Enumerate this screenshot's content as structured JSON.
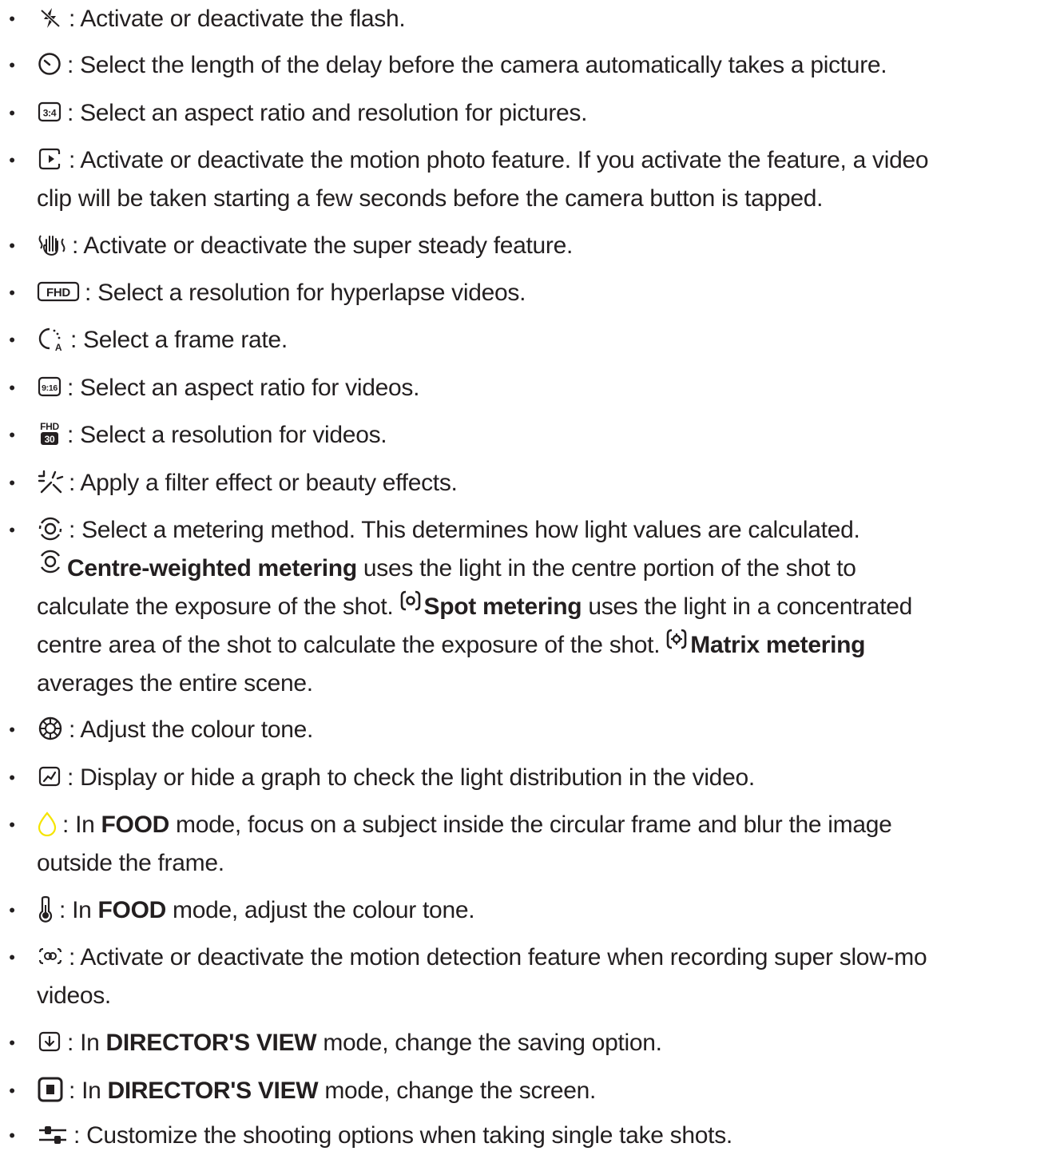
{
  "items": [
    {
      "icon": "flash-off-icon",
      "text": ": Activate or deactivate the flash."
    },
    {
      "icon": "timer-icon",
      "text": ": Select the length of the delay before the camera automatically takes a picture."
    },
    {
      "icon": "aspect-ratio-3-4-icon",
      "icon_text": "3:4",
      "text": ": Select an aspect ratio and resolution for pictures."
    },
    {
      "icon": "motion-photo-icon",
      "text": ": Activate or deactivate the motion photo feature. If you activate the feature, a video",
      "text2": "clip will be taken starting a few seconds before the camera button is tapped."
    },
    {
      "icon": "super-steady-hand-icon",
      "text": ": Activate or deactivate the super steady feature."
    },
    {
      "icon": "fhd-resolution-icon",
      "icon_text": "FHD",
      "text": ": Select a resolution for hyperlapse videos."
    },
    {
      "icon": "frame-rate-auto-icon",
      "icon_text": "A",
      "text": ": Select a frame rate."
    },
    {
      "icon": "aspect-ratio-9-16-icon",
      "icon_text": "9:16",
      "text": ": Select an aspect ratio for videos."
    },
    {
      "icon": "video-resolution-fhd30-icon",
      "icon_text": "FHD",
      "icon_text2": "30",
      "text": ": Select a resolution for videos."
    },
    {
      "icon": "filter-effects-icon",
      "text": ": Apply a filter effect or beauty effects."
    },
    {
      "icon": "metering-icon",
      "text": ": Select a metering method. This determines how light values are calculated.",
      "centre_bold": "Centre-weighted metering",
      "centre_rest": " uses the light in the centre portion of the shot to",
      "line3_a": "calculate the exposure of the shot.",
      "spot_bold": "Spot metering",
      "line3_b": " uses the light in a concentrated",
      "line4_a": "centre area of the shot to calculate the exposure of the shot.",
      "matrix_bold": "Matrix metering",
      "line5": "averages the entire scene."
    },
    {
      "icon": "colour-tone-icon",
      "text": ": Adjust the colour tone."
    },
    {
      "icon": "histogram-graph-icon",
      "text": ": Display or hide a graph to check the light distribution in the video."
    },
    {
      "icon": "food-focus-drop-icon",
      "pre": ": In ",
      "bold": "FOOD",
      "post": " mode, focus on a subject inside the circular frame and blur the image",
      "text2": "outside the frame.",
      "accent": "#f5e400"
    },
    {
      "icon": "thermometer-icon",
      "pre": ": In ",
      "bold": "FOOD",
      "post": " mode, adjust the colour tone."
    },
    {
      "icon": "motion-detection-icon",
      "text": ": Activate or deactivate the motion detection feature when recording super slow-mo",
      "text2": "videos."
    },
    {
      "icon": "save-option-icon",
      "pre": ": In ",
      "bold": "DIRECTOR'S VIEW",
      "post": " mode, change the saving option."
    },
    {
      "icon": "screen-change-icon",
      "pre": ": In ",
      "bold": "DIRECTOR'S VIEW",
      "post": " mode, change the screen."
    },
    {
      "icon": "shooting-options-sliders-icon",
      "text": ": Customize the shooting options when taking single take shots."
    }
  ],
  "bullet": "•"
}
